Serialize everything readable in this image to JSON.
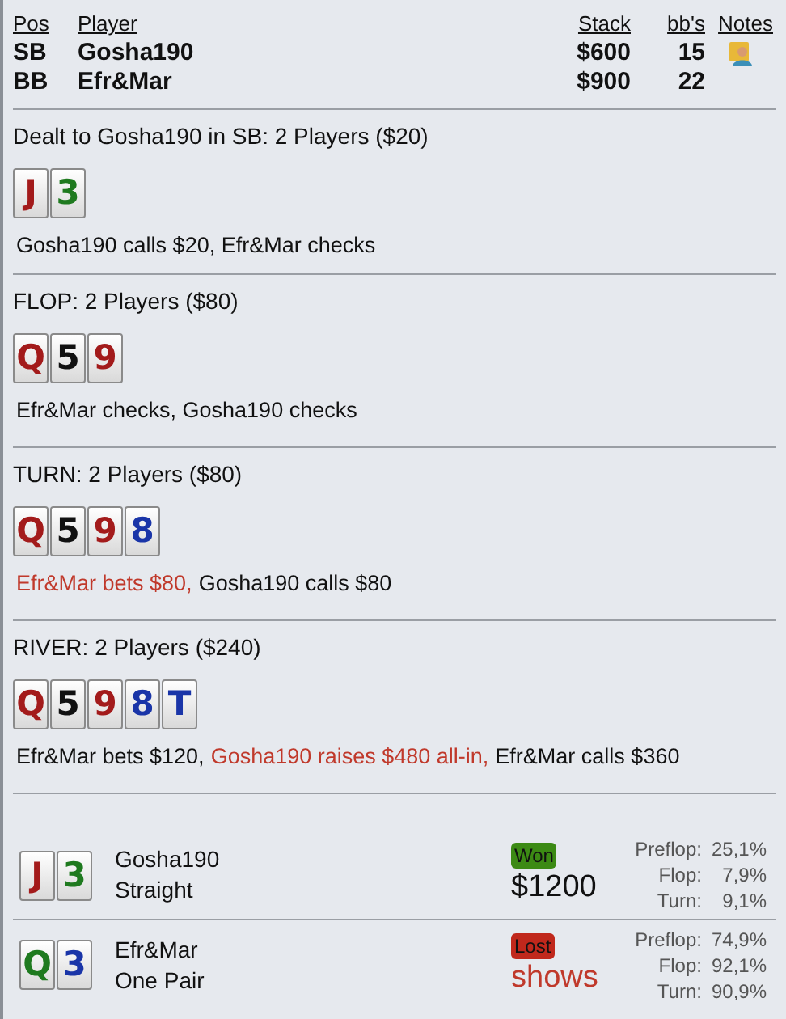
{
  "players_table": {
    "columns": [
      "Pos",
      "Player",
      "Stack",
      "bb's",
      "Notes"
    ],
    "rows": [
      {
        "pos": "SB",
        "player": "Gosha190",
        "stack": "$600",
        "bbs": "15",
        "has_note": true
      },
      {
        "pos": "BB",
        "player": "Efr&Mar",
        "stack": "$900",
        "bbs": "22",
        "has_note": false
      }
    ]
  },
  "streets": [
    {
      "heading": "Dealt to Gosha190 in SB: 2 Players ($20)",
      "cards": [
        {
          "rank": "J",
          "color": "#a31b1b"
        },
        {
          "rank": "3",
          "color": "#1f7a1f"
        }
      ],
      "actions": [
        {
          "text": "Gosha190 calls $20, Efr&Mar checks",
          "aggressive": false
        }
      ]
    },
    {
      "heading": "FLOP: 2 Players ($80)",
      "cards": [
        {
          "rank": "Q",
          "color": "#a31b1b"
        },
        {
          "rank": "5",
          "color": "#111111"
        },
        {
          "rank": "9",
          "color": "#a31b1b"
        }
      ],
      "actions": [
        {
          "text": "Efr&Mar checks, Gosha190 checks",
          "aggressive": false
        }
      ]
    },
    {
      "heading": "TURN: 2 Players ($80)",
      "cards": [
        {
          "rank": "Q",
          "color": "#a31b1b"
        },
        {
          "rank": "5",
          "color": "#111111"
        },
        {
          "rank": "9",
          "color": "#a31b1b"
        },
        {
          "rank": "8",
          "color": "#1a35a8"
        }
      ],
      "actions": [
        {
          "text": "Efr&Mar bets $80,",
          "aggressive": true
        },
        {
          "text": "Gosha190 calls $80",
          "aggressive": false
        }
      ]
    },
    {
      "heading": "RIVER: 2 Players ($240)",
      "cards": [
        {
          "rank": "Q",
          "color": "#a31b1b"
        },
        {
          "rank": "5",
          "color": "#111111"
        },
        {
          "rank": "9",
          "color": "#a31b1b"
        },
        {
          "rank": "8",
          "color": "#1a35a8"
        },
        {
          "rank": "T",
          "color": "#1a35a8"
        }
      ],
      "actions": [
        {
          "text": "Efr&Mar bets $120,",
          "aggressive": false
        },
        {
          "text": "Gosha190 raises $480 all-in,",
          "aggressive": true
        },
        {
          "text": "Efr&Mar calls $360",
          "aggressive": false
        }
      ]
    }
  ],
  "results": [
    {
      "cards": [
        {
          "rank": "J",
          "color": "#a31b1b"
        },
        {
          "rank": "3",
          "color": "#1f7a1f"
        }
      ],
      "player": "Gosha190",
      "hand": "Straight",
      "outcome": {
        "kind": "won",
        "label": "Won"
      },
      "amount": "$1200",
      "equity": [
        {
          "street": "Preflop:",
          "value": "25,1%"
        },
        {
          "street": "Flop:",
          "value": "7,9%"
        },
        {
          "street": "Turn:",
          "value": "9,1%"
        }
      ]
    },
    {
      "cards": [
        {
          "rank": "Q",
          "color": "#1f7a1f"
        },
        {
          "rank": "3",
          "color": "#1a35a8"
        }
      ],
      "player": "Efr&Mar",
      "hand": "One Pair",
      "outcome": {
        "kind": "lost",
        "label": "Lost"
      },
      "amount": "shows",
      "equity": [
        {
          "street": "Preflop:",
          "value": "74,9%"
        },
        {
          "street": "Flop:",
          "value": "92,1%"
        },
        {
          "street": "Turn:",
          "value": "90,9%"
        }
      ]
    }
  ]
}
